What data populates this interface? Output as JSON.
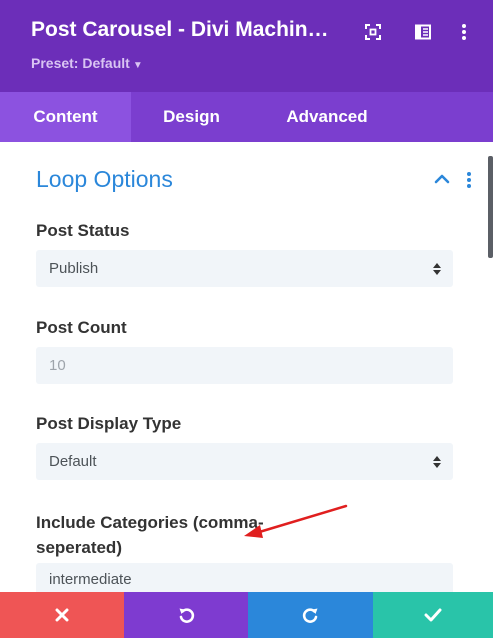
{
  "header": {
    "title": "Post Carousel - Divi Machin…",
    "preset_label": "Preset: Default",
    "bg_color": "#6c2eb9",
    "icons": [
      "expand-icon",
      "sidebar-toggle-icon",
      "more-vertical-icon"
    ]
  },
  "tabs": [
    {
      "label": "Content",
      "active": true
    },
    {
      "label": "Design",
      "active": false
    },
    {
      "label": "Advanced",
      "active": false
    }
  ],
  "section": {
    "title": "Loop Options",
    "accent_color": "#2b87da"
  },
  "fields": {
    "post_status": {
      "label": "Post Status",
      "value": "Publish"
    },
    "post_count": {
      "label": "Post Count",
      "value": "10"
    },
    "post_display_type": {
      "label": "Post Display Type",
      "value": "Default"
    },
    "include_categories": {
      "label_line1": "Include Categories (comma-",
      "label_line2": "seperated)",
      "value": "intermediate"
    }
  },
  "footer": {
    "buttons": [
      {
        "name": "cancel",
        "icon": "close-icon",
        "color": "#ef5555"
      },
      {
        "name": "undo",
        "icon": "undo-icon",
        "color": "#7e3bd0"
      },
      {
        "name": "redo",
        "icon": "redo-icon",
        "color": "#2b87da"
      },
      {
        "name": "save",
        "icon": "check-icon",
        "color": "#29c4a9"
      }
    ]
  }
}
